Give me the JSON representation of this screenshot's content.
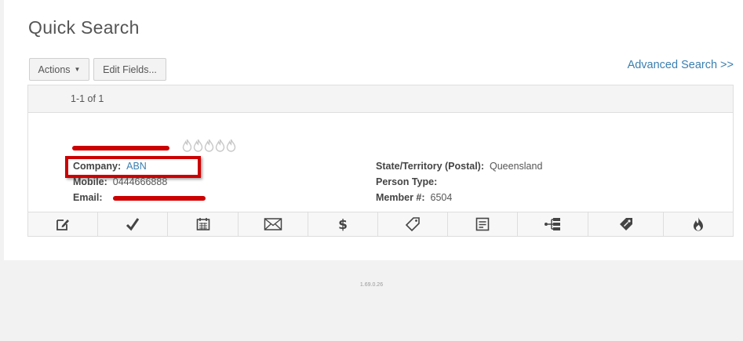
{
  "page": {
    "title": "Quick Search"
  },
  "toolbar": {
    "actions_label": "Actions",
    "edit_fields_label": "Edit Fields..."
  },
  "advanced_search": {
    "label": "Advanced Search >>"
  },
  "results": {
    "count": "1-1 of 1",
    "record": {
      "name": "",
      "rating_max": 5,
      "fields_left": [
        {
          "label": "Company:",
          "value": "ABN"
        },
        {
          "label": "Mobile:",
          "value": "0444666888"
        },
        {
          "label": "Email:",
          "value": ""
        }
      ],
      "fields_right": [
        {
          "label": "State/Territory (Postal):",
          "value": "Queensland"
        },
        {
          "label": "Person Type:",
          "value": ""
        },
        {
          "label": "Member #:",
          "value": "6504"
        }
      ]
    },
    "actions": [
      {
        "icon": "edit-icon"
      },
      {
        "icon": "checkmark-icon"
      },
      {
        "icon": "calendar-icon"
      },
      {
        "icon": "envelope-icon"
      },
      {
        "icon": "dollar-icon"
      },
      {
        "icon": "tag-icon"
      },
      {
        "icon": "note-icon"
      },
      {
        "icon": "hierarchy-icon"
      },
      {
        "icon": "price-tag-icon"
      },
      {
        "icon": "flame-icon"
      }
    ]
  },
  "footer": {
    "version": "1.69.0.26"
  },
  "colors": {
    "link": "#3b7fb0",
    "redaction": "#cc0000"
  }
}
